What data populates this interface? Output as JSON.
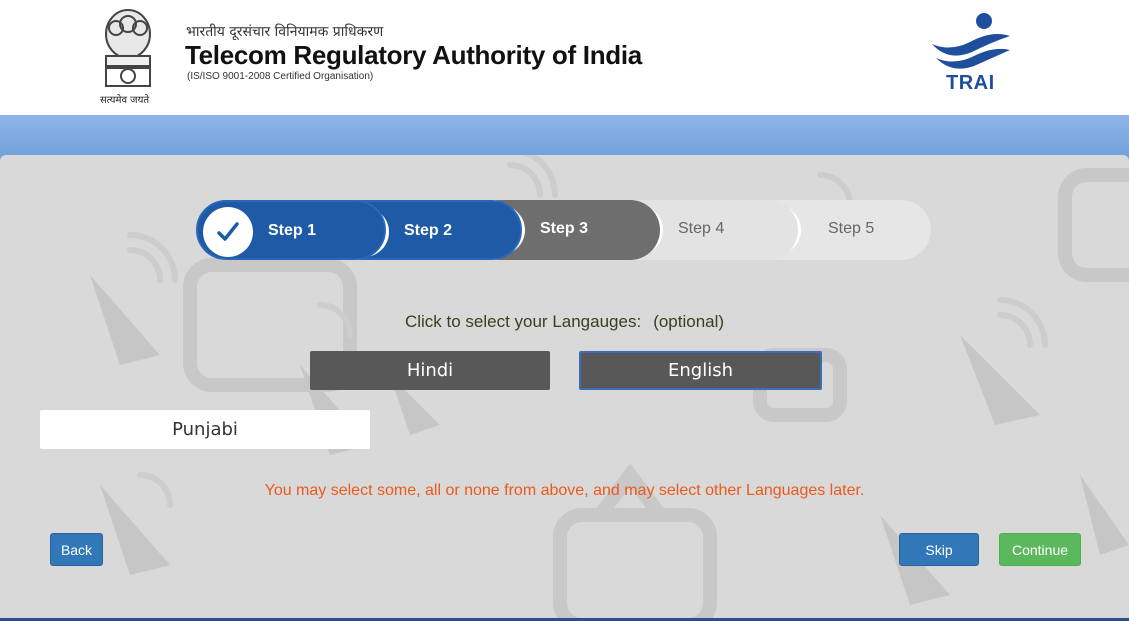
{
  "header": {
    "emblem_motto": "सत्यमेव जयते",
    "hindi_name": "भारतीय दूरसंचार विनियामक प्राधिकरण",
    "title": "Telecom Regulatory Authority of India",
    "subtitle": "(IS/ISO 9001-2008 Certified Organisation)",
    "logo_text": "TRAI",
    "logo_icon": "trai-logo-icon",
    "emblem_icon": "national-emblem-icon"
  },
  "stepper": {
    "steps": [
      {
        "number": "1",
        "label": "Step 1",
        "state": "completed"
      },
      {
        "number": "2",
        "label": "Step 2",
        "state": "completed"
      },
      {
        "number": "3",
        "label": "Step 3",
        "state": "current"
      },
      {
        "number": "4",
        "label": "Step 4",
        "state": "upcoming"
      },
      {
        "number": "5",
        "label": "Step 5",
        "state": "upcoming"
      }
    ]
  },
  "main": {
    "prompt": "Click to select your Langauges:",
    "prompt_optional": "(optional)",
    "languages": [
      {
        "label": "Hindi",
        "selected": false
      },
      {
        "label": "English",
        "selected": true
      },
      {
        "label": "Punjabi",
        "selected": false
      }
    ],
    "notice": "You may select some, all or none from above, and may select other Languages later."
  },
  "actions": {
    "back": "Back",
    "skip": "Skip",
    "continue": "Continue"
  },
  "colors": {
    "primary_blue": "#1f5aa6",
    "band_blue": "#7ea9e0",
    "notice_orange": "#ec5a1c",
    "continue_green": "#5cb85c",
    "panel_gray": "#d9d9d9"
  }
}
